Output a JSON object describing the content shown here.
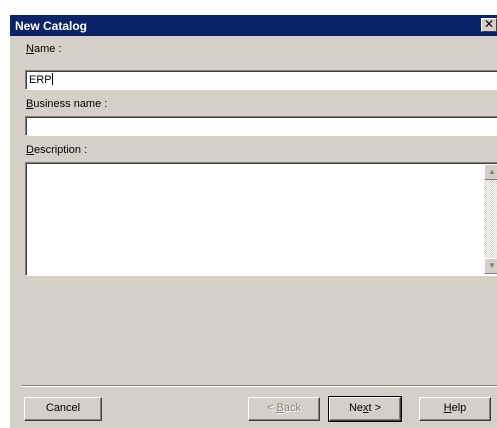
{
  "dialog": {
    "title": "New Catalog",
    "close_symbol": "✕"
  },
  "fields": {
    "name_label_key": "N",
    "name_label_rest": "ame :",
    "name_value": "ERP",
    "business_label_key": "B",
    "business_label_rest": "usiness name :",
    "business_value": "",
    "description_label_key": "D",
    "description_label_rest": "escription :",
    "description_value": ""
  },
  "scrollbar": {
    "up_icon": "▲",
    "down_icon": "▼"
  },
  "buttons": {
    "cancel": "Cancel",
    "back_prefix": "< ",
    "back_key": "B",
    "back_rest": "ack",
    "next_prefix": "Ne",
    "next_key": "x",
    "next_rest": "t >",
    "help_key": "H",
    "help_rest": "elp"
  },
  "colors": {
    "titlebar": "#0a246a",
    "dialog_face": "#d4d0c8",
    "disabled_text": "#808080"
  }
}
